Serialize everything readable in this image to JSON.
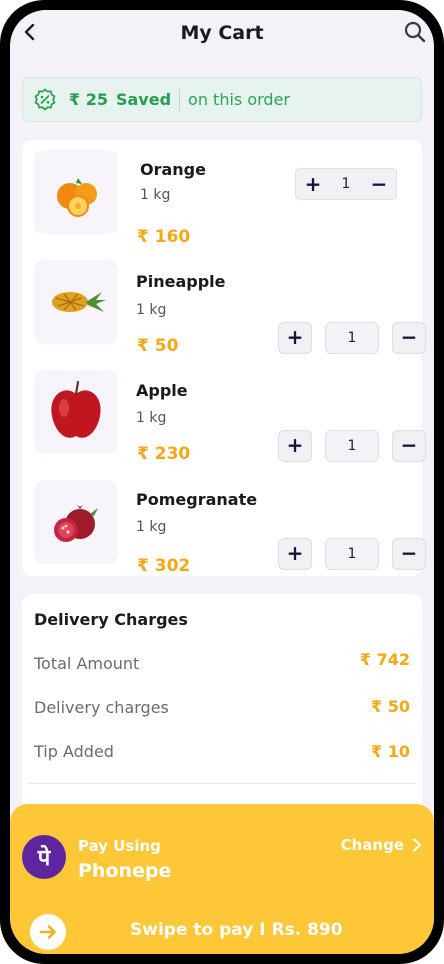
{
  "header": {
    "title": "My Cart",
    "back_icon": "chevron-left-icon",
    "search_icon": "search-icon"
  },
  "savings": {
    "icon": "discount-badge-icon",
    "amount": "₹ 25",
    "label": "Saved",
    "note": "on this order",
    "color": "#23a04f"
  },
  "cart": {
    "items": [
      {
        "name": "Orange",
        "quantity_label": "1 kg",
        "price": "₹ 160",
        "count": "1",
        "image": "orange-icon"
      },
      {
        "name": "Pineapple",
        "quantity_label": "1 kg",
        "price": "₹ 50",
        "count": "1",
        "image": "pineapple-icon"
      },
      {
        "name": "Apple",
        "quantity_label": "1 kg",
        "price": "₹ 230",
        "count": "1",
        "image": "apple-icon"
      },
      {
        "name": "Pomegranate",
        "quantity_label": "1 kg",
        "price": "₹ 302",
        "count": "1",
        "image": "pomegranate-icon"
      }
    ],
    "plus_label": "+",
    "minus_label": "−"
  },
  "delivery": {
    "title": "Delivery Charges",
    "rows": [
      {
        "label": "Total Amount",
        "value": "₹ 742"
      },
      {
        "label": "Delivery charges",
        "value": "₹ 50"
      },
      {
        "label": "Tip Added",
        "value": "₹ 10"
      }
    ]
  },
  "payment": {
    "pay_using_label": "Pay Using",
    "method": "Phonepe",
    "method_logo_glyph": "पे",
    "change_label": "Change",
    "swipe_text": "Swipe to pay I Rs. 890",
    "panel_color": "#fec737",
    "brand_color": "#5f259f"
  },
  "colors": {
    "accent_price": "#f5a816",
    "stepper_text": "#15163a",
    "background": "#f4f2f9"
  }
}
